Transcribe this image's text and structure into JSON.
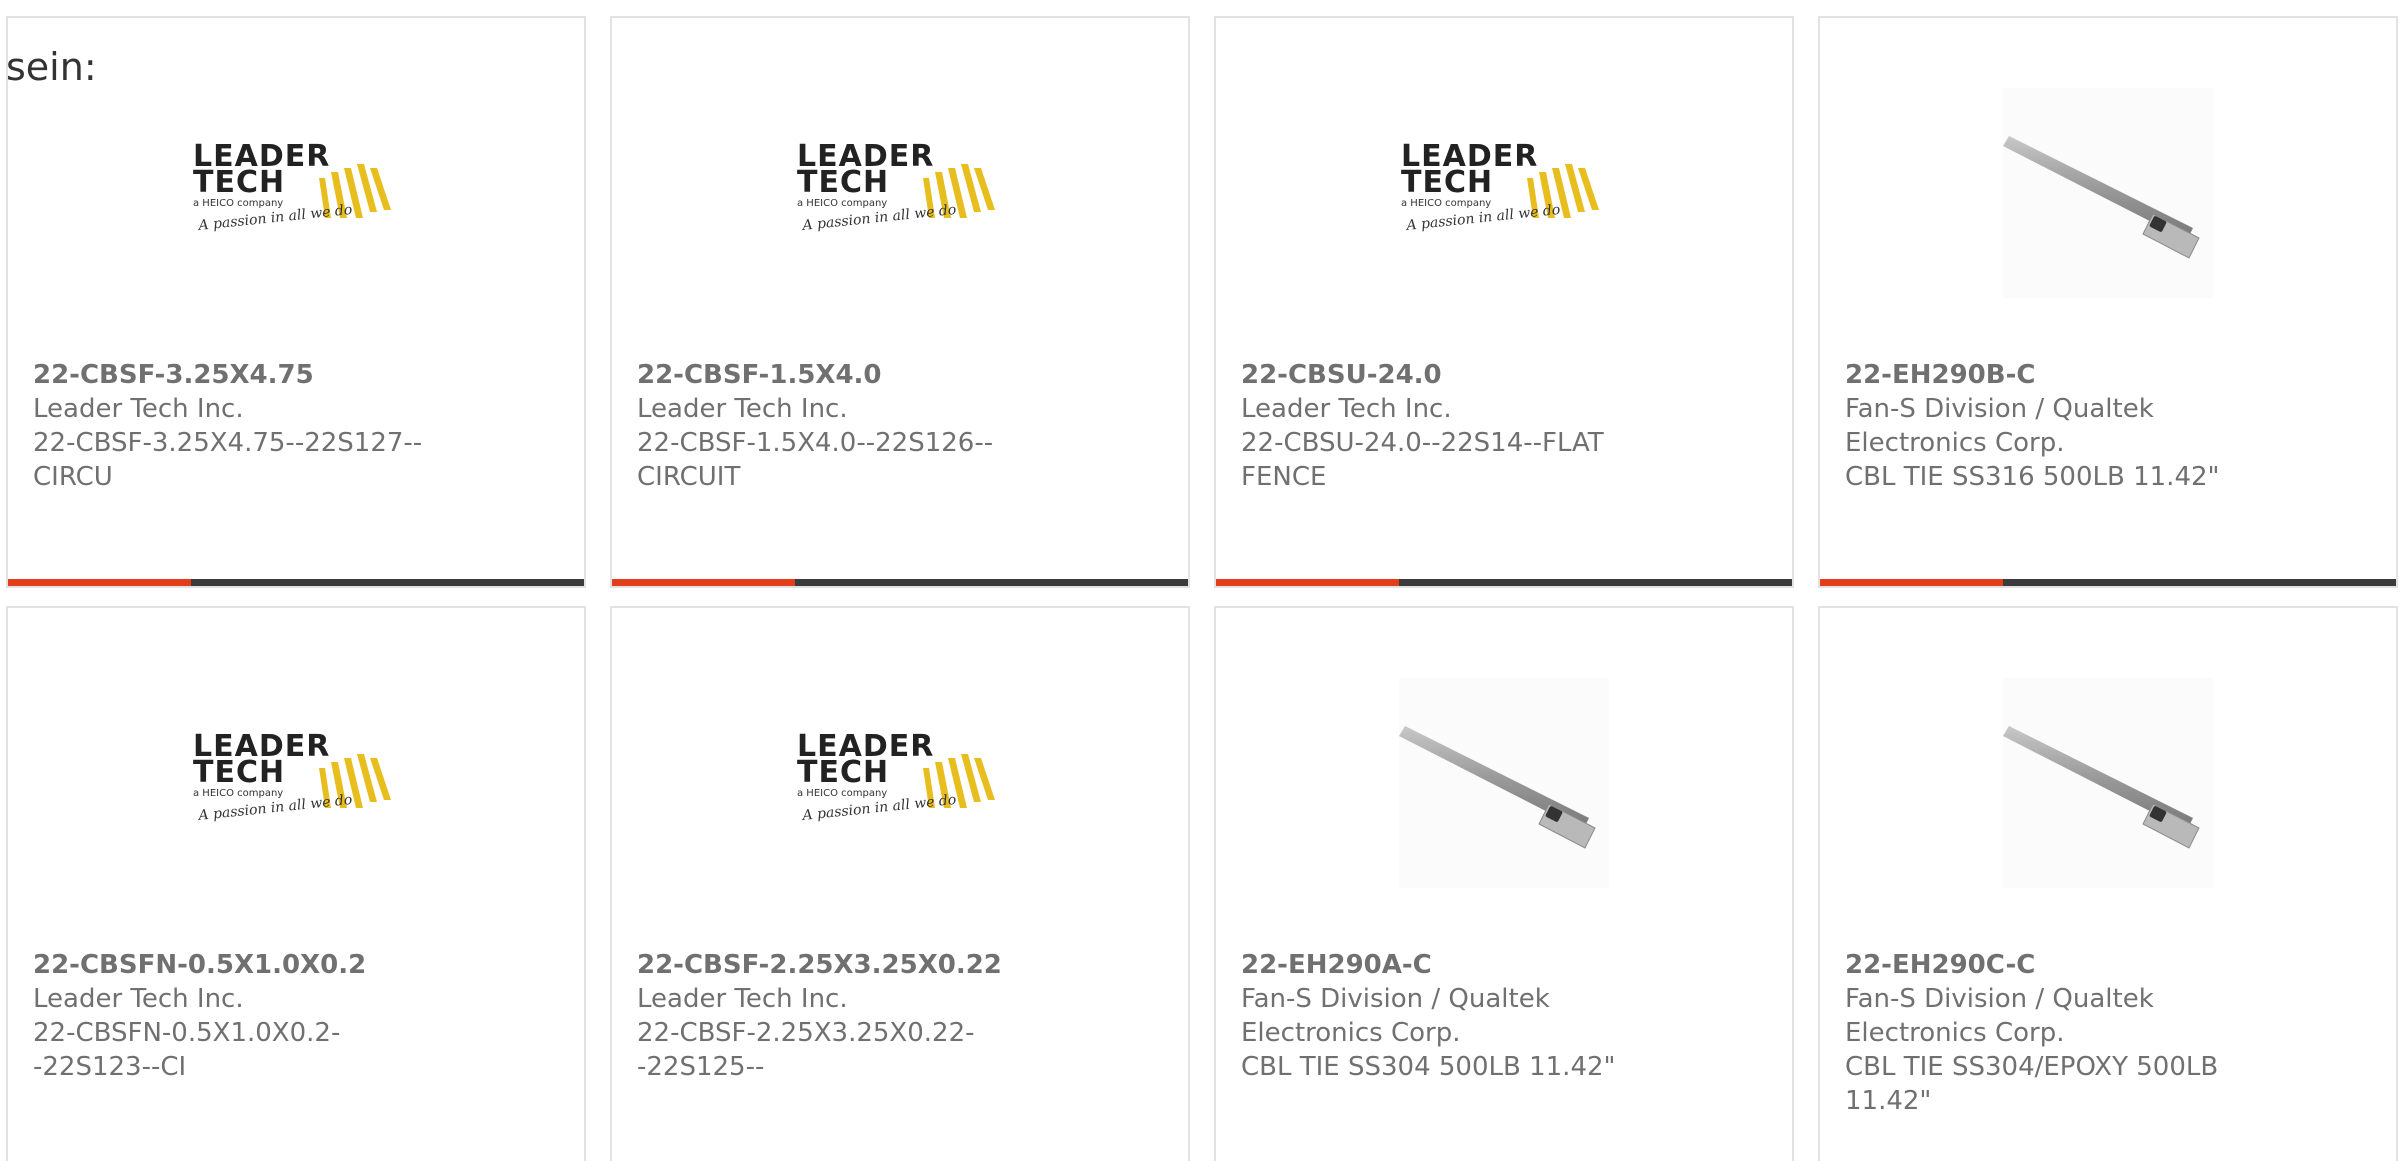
{
  "intro_text": "sein:",
  "colors": {
    "accent": "#e43d1b",
    "bar": "#3b3b3b",
    "logo_yellow": "#e8be1e",
    "text": "#707070"
  },
  "products": [
    {
      "part_number": "22-CBSF-3.25X4.75",
      "manufacturer": "Leader Tech Inc.",
      "description": "22-CBSF-3.25X4.75--22S127--CIRCU",
      "image": "leader-tech-logo",
      "logo": {
        "line1": "LEADER",
        "line2": "TECH",
        "tagline": "a HEICO company",
        "script": "A passion in all we do"
      }
    },
    {
      "part_number": "22-CBSF-1.5X4.0",
      "manufacturer": "Leader Tech Inc.",
      "description": "22-CBSF-1.5X4.0--22S126--CIRCUIT",
      "image": "leader-tech-logo",
      "logo": {
        "line1": "LEADER",
        "line2": "TECH",
        "tagline": "a HEICO company",
        "script": "A passion in all we do"
      }
    },
    {
      "part_number": "22-CBSU-24.0",
      "manufacturer": "Leader Tech Inc.",
      "description": "22-CBSU-24.0--22S14--FLAT FENCE",
      "image": "leader-tech-logo",
      "logo": {
        "line1": "LEADER",
        "line2": "TECH",
        "tagline": "a HEICO company",
        "script": "A passion in all we do"
      }
    },
    {
      "part_number": "22-EH290B-C",
      "manufacturer": "Fan-S Division / Qualtek Electronics Corp.",
      "description": "CBL TIE SS316 500LB 11.42\"",
      "image": "stainless-cable-tie"
    },
    {
      "part_number": "22-CBSFN-0.5X1.0X0.2",
      "manufacturer": "Leader Tech Inc.",
      "description": "22-CBSFN-0.5X1.0X0.2--22S123--CI",
      "image": "leader-tech-logo",
      "logo": {
        "line1": "LEADER",
        "line2": "TECH",
        "tagline": "a HEICO company",
        "script": "A passion in all we do"
      }
    },
    {
      "part_number": "22-CBSF-2.25X3.25X0.22",
      "manufacturer": "Leader Tech Inc.",
      "description": "22-CBSF-2.25X3.25X0.22--22S125--",
      "image": "leader-tech-logo",
      "logo": {
        "line1": "LEADER",
        "line2": "TECH",
        "tagline": "a HEICO company",
        "script": "A passion in all we do"
      }
    },
    {
      "part_number": "22-EH290A-C",
      "manufacturer": "Fan-S Division / Qualtek Electronics Corp.",
      "description": "CBL TIE SS304 500LB 11.42\"",
      "image": "stainless-cable-tie"
    },
    {
      "part_number": "22-EH290C-C",
      "manufacturer": "Fan-S Division / Qualtek Electronics Corp.",
      "description": "CBL TIE SS304/EPOXY 500LB 11.42\"",
      "image": "stainless-cable-tie"
    }
  ]
}
